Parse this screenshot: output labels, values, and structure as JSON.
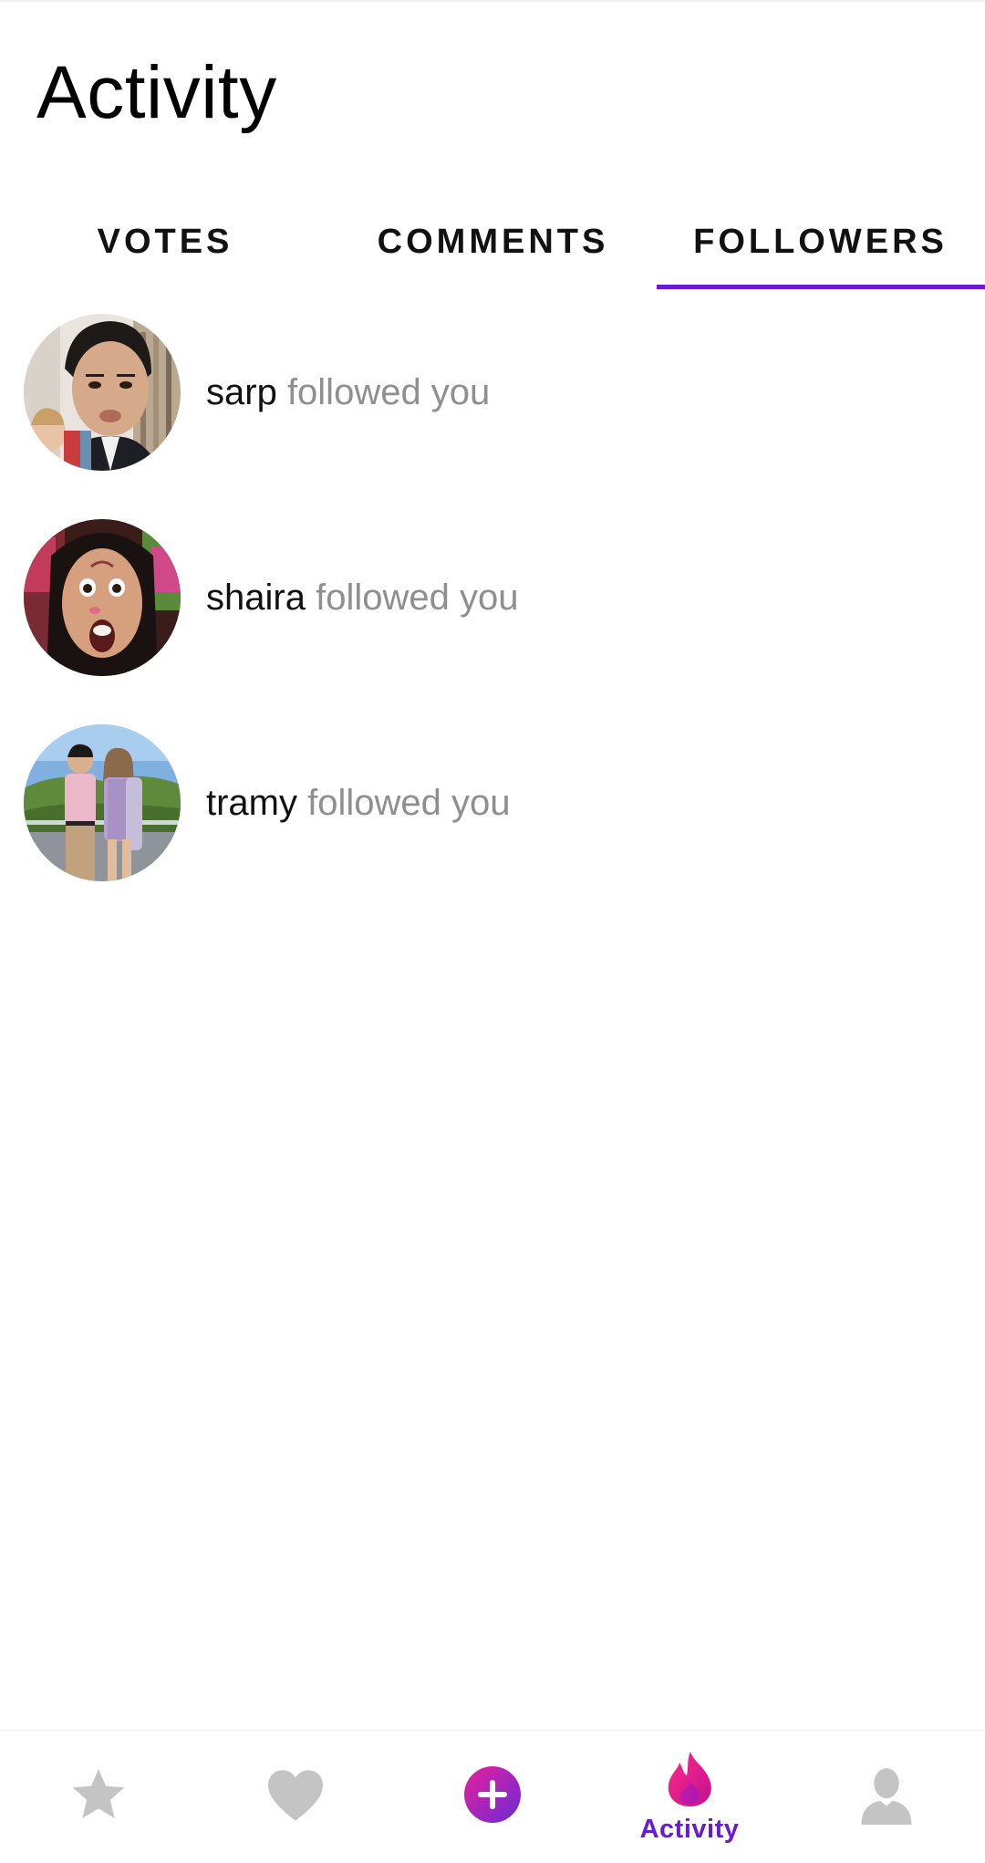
{
  "header": {
    "title": "Activity"
  },
  "tabs": [
    {
      "label": "VOTES",
      "selected": false
    },
    {
      "label": "COMMENTS",
      "selected": false
    },
    {
      "label": "FOLLOWERS",
      "selected": true
    }
  ],
  "followers": [
    {
      "username": "sarp",
      "action": "followed you"
    },
    {
      "username": "shaira",
      "action": "followed you"
    },
    {
      "username": "tramy",
      "action": "followed you"
    }
  ],
  "bottom_nav": {
    "items": [
      {
        "icon": "star-icon",
        "label": ""
      },
      {
        "icon": "heart-icon",
        "label": ""
      },
      {
        "icon": "add-post-icon",
        "label": ""
      },
      {
        "icon": "flame-icon",
        "label": "Activity",
        "active": true
      },
      {
        "icon": "profile-icon",
        "label": ""
      }
    ]
  },
  "colors": {
    "accent": "#6a1bd0",
    "inactive_icon": "#c4c4c4",
    "secondary_text": "#8f8f8f",
    "flame_pink": "#e0148f"
  }
}
